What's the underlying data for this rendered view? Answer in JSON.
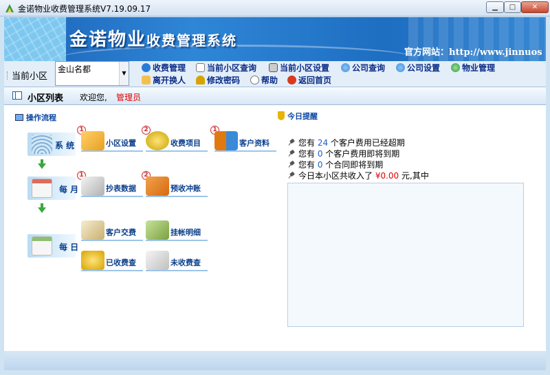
{
  "window": {
    "title": "金诺物业收费管理系统V7.19.09.17",
    "min_glyph": "▁",
    "max_glyph": "□",
    "close_glyph": "✕"
  },
  "banner": {
    "title_big": "金诺物业",
    "title_small": "收费管理系统",
    "site": "官方网站：http://www.jinnuos"
  },
  "toolbar": {
    "community_label": "当前小区",
    "community_value": "金山名都",
    "menu": [
      {
        "label": "收费管理",
        "icon": "coins-icon",
        "color": "#2a7bd8"
      },
      {
        "label": "当前小区查询",
        "icon": "document-icon",
        "color": "#7a7a7a"
      },
      {
        "label": "当前小区设置",
        "icon": "computer-icon",
        "color": "#555555"
      },
      {
        "label": "公司查询",
        "icon": "globe-icon",
        "color": "#3d8ee0"
      },
      {
        "label": "公司设置",
        "icon": "globe-gear-icon",
        "color": "#3d8ee0"
      },
      {
        "label": "物业管理",
        "icon": "earth-icon",
        "color": "#2f9a3a"
      },
      {
        "label": "离开换人",
        "icon": "users-icon",
        "color": "#d99a1a"
      },
      {
        "label": "修改密码",
        "icon": "key-icon",
        "color": "#d6a400"
      },
      {
        "label": "帮助",
        "icon": "help-icon",
        "color": "#777777"
      },
      {
        "label": "返回首页",
        "icon": "home-icon",
        "color": "#d9391f"
      }
    ]
  },
  "tab": {
    "title": "小区列表",
    "welcome": "欢迎您,",
    "user": "管理员"
  },
  "flow": {
    "header": "操作流程",
    "stages": [
      {
        "label": "系 统"
      },
      {
        "label": "每 月"
      },
      {
        "label": "每 日"
      }
    ],
    "buttons": [
      {
        "label": "小区设置",
        "badge": "1",
        "icon": "cubes-icon",
        "color": "#e8a020"
      },
      {
        "label": "收费项目",
        "badge": "2",
        "icon": "coins-stack-icon",
        "color": "#c9a400"
      },
      {
        "label": "客户资料",
        "badge": "1",
        "icon": "people-icon",
        "color": "#e07a10"
      },
      {
        "label": "抄表数据",
        "badge": "1",
        "icon": "pen-paper-icon",
        "color": "#b0b0b0"
      },
      {
        "label": "预收冲账",
        "badge": "2",
        "icon": "books-icon",
        "color": "#d66a10"
      },
      {
        "label": "客户交费",
        "badge": "",
        "icon": "money-envelope-icon",
        "color": "#c8b070"
      },
      {
        "label": "挂帐明细",
        "badge": "",
        "icon": "cash-stack-icon",
        "color": "#7aa040"
      },
      {
        "label": "已收费查",
        "badge": "",
        "icon": "coins-tray-icon",
        "color": "#d6a400"
      },
      {
        "label": "未收费查",
        "badge": "",
        "icon": "pen-coins-icon",
        "color": "#c0c0c0"
      }
    ]
  },
  "reminders": {
    "header": "今日提醒",
    "items": [
      {
        "pre": "您有 ",
        "num": "24",
        "post": " 个客户费用已经超期"
      },
      {
        "pre": "您有 ",
        "num": "0",
        "post": " 个客户费用即将到期"
      },
      {
        "pre": "您有 ",
        "num": "0",
        "post": " 个合同即将到期"
      },
      {
        "pre": "今日本小区共收入了 ",
        "num": "¥0.00",
        "post": " 元,其中"
      }
    ]
  }
}
